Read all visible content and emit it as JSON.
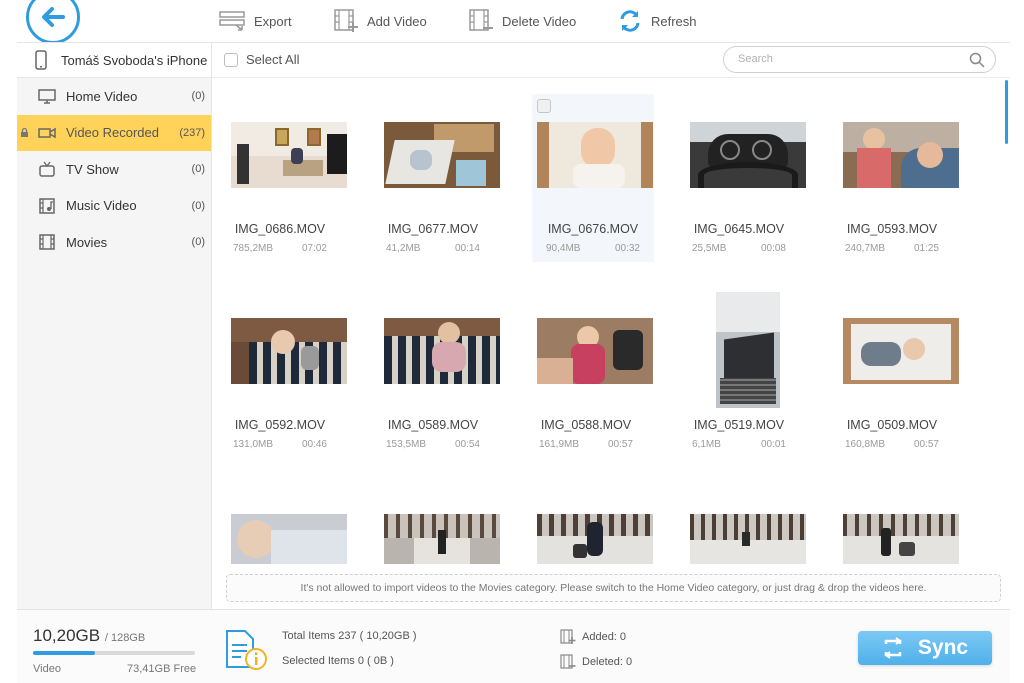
{
  "toolbar": {
    "export_label": "Export",
    "add_label": "Add Video",
    "delete_label": "Delete Video",
    "refresh_label": "Refresh",
    "accent": "#2f9ce0"
  },
  "sidebar": {
    "device_name": "Tomáš Svoboda's iPhone",
    "items": [
      {
        "label": "Home Video",
        "count": "(0)",
        "icon": "monitor-icon"
      },
      {
        "label": "Video Recorded",
        "count": "(237)",
        "icon": "video-camera-icon",
        "active": true
      },
      {
        "label": "TV Show",
        "count": "(0)",
        "icon": "tv-icon"
      },
      {
        "label": "Music Video",
        "count": "(0)",
        "icon": "music-video-icon"
      },
      {
        "label": "Movies",
        "count": "(0)",
        "icon": "film-icon"
      }
    ],
    "active_color": "#ffd35a"
  },
  "list": {
    "select_all_label": "Select All",
    "search_placeholder": "Search"
  },
  "videos": [
    {
      "name": "IMG_0686.MOV",
      "size": "785,2MB",
      "duration": "07:02"
    },
    {
      "name": "IMG_0677.MOV",
      "size": "41,2MB",
      "duration": "00:14"
    },
    {
      "name": "IMG_0676.MOV",
      "size": "90,4MB",
      "duration": "00:32"
    },
    {
      "name": "IMG_0645.MOV",
      "size": "25,5MB",
      "duration": "00:08"
    },
    {
      "name": "IMG_0593.MOV",
      "size": "240,7MB",
      "duration": "01:25"
    },
    {
      "name": "IMG_0592.MOV",
      "size": "131,0MB",
      "duration": "00:46"
    },
    {
      "name": "IMG_0589.MOV",
      "size": "153,5MB",
      "duration": "00:54"
    },
    {
      "name": "IMG_0588.MOV",
      "size": "161,9MB",
      "duration": "00:57"
    },
    {
      "name": "IMG_0519.MOV",
      "size": "6,1MB",
      "duration": "00:01"
    },
    {
      "name": "IMG_0509.MOV",
      "size": "160,8MB",
      "duration": "00:57"
    },
    {
      "name": "",
      "size": "",
      "duration": ""
    },
    {
      "name": "",
      "size": "",
      "duration": ""
    },
    {
      "name": "",
      "size": "",
      "duration": ""
    },
    {
      "name": "",
      "size": "",
      "duration": ""
    },
    {
      "name": "",
      "size": "",
      "duration": ""
    }
  ],
  "notice": "It's not allowed to  import videos to the Movies category.  Please switch to the Home Video category, or just drag & drop the videos here.",
  "status": {
    "used": "10,20GB",
    "total": "/ 128GB",
    "used_fraction": 0.38,
    "type_label": "Video",
    "free": "73,41GB Free",
    "total_items": "Total Items  237  ( 10,20GB )",
    "selected_items": "Selected Items  0  ( 0B )",
    "added": "Added:  0",
    "deleted": "Deleted:  0",
    "sync_label": "Sync"
  }
}
